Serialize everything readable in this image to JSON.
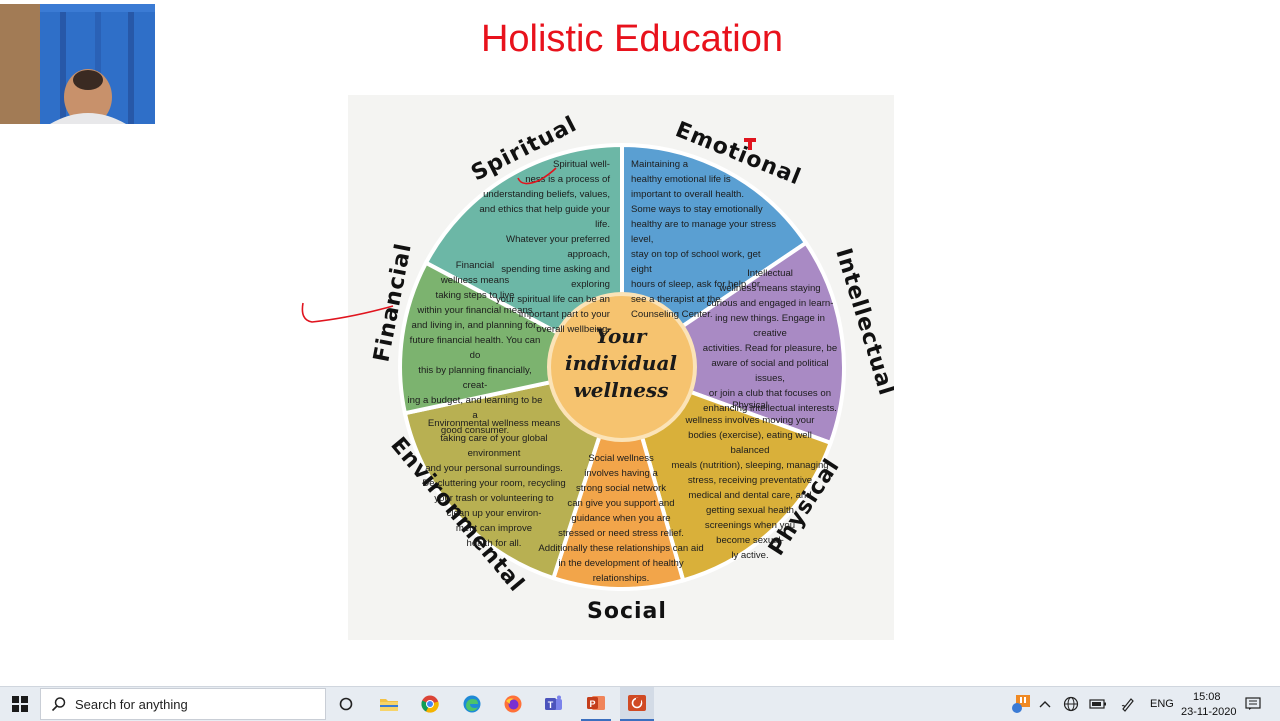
{
  "slide": {
    "title": "Holistic Education"
  },
  "diagram": {
    "center": "Your\nindividual\nwellness",
    "categories": {
      "spiritual": "Spiritual",
      "emotional": "Emotional",
      "intellectual": "Intellectual",
      "physical": "Physical",
      "social": "Social",
      "environmental": "Environmental",
      "financial": "Financial"
    },
    "texts": {
      "spiritual": "Spiritual well-\nness is a process of\nunderstanding beliefs, values,\nand ethics that help guide your life.\nWhatever your preferred approach,\nspending time asking and exploring\nyour spiritual life can be an\nimportant part to your\noverall wellbeing.",
      "emotional": "Maintaining a\nhealthy emotional life is\nimportant to overall health.\nSome ways to stay emotionally\nhealthy are to manage your stress level,\nstay on top of school work, get eight\nhours of sleep, ask for help, or\nsee a therapist at the\nCounseling Center.",
      "intellectual": "Intellectual\nwellness means staying\ncurious and engaged in learn-\ning new things. Engage in creative\nactivities. Read for pleasure, be\naware of social and political issues,\nor join a club that focuses on\nenhancing intellectual interests.",
      "physical": "Physical\nwellness involves moving your\nbodies (exercise), eating well balanced\nmeals (nutrition), sleeping, managing\nstress, receiving preventative\nmedical and dental care, and\ngetting sexual health\nscreenings when you\nbecome sexual-\nly active.",
      "social": "Social wellness\ninvolves having a\nstrong social network\ncan give you support and\nguidance when you are\nstressed or need stress relief.\nAdditionally these relationships can aid\nin the development of healthy\nrelationships.",
      "environmental": "Environmental wellness means\ntaking care of your global environment\nand your personal surroundings.\nDe-cluttering your room, recycling\nyour trash or volunteering to\nclean up your environ-\nment can improve\nhealth for all.",
      "financial": "Financial\nwellness means\ntaking steps to live\nwithin your financial means\nand living in, and planning for,\nfuture financial health. You can do\nthis by planning financially, creat-\ning a budget, and learning to be a\ngood consumer."
    },
    "colors": {
      "spiritual": "#6cb7a6",
      "emotional": "#5a9fd2",
      "intellectual": "#a98ac4",
      "physical": "#d9b03a",
      "social": "#f2a54a",
      "environmental": "#b8b052",
      "financial": "#7cb36f",
      "center": "#f6c36f"
    }
  },
  "taskbar": {
    "search_placeholder": "Search for anything",
    "language": "ENG",
    "time": "15:08",
    "date": "23-11-2020"
  }
}
